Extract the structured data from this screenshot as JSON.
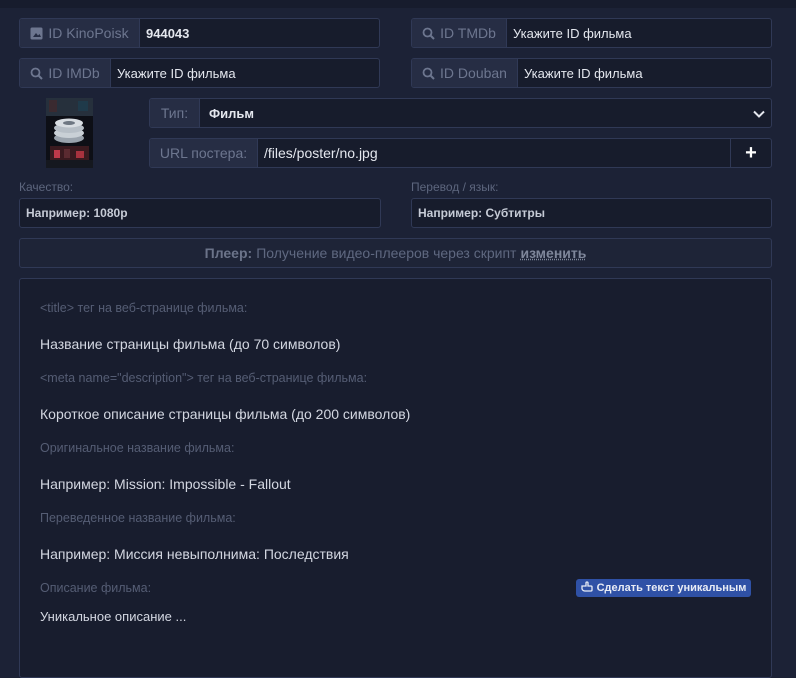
{
  "ids": {
    "kinopoisk": {
      "label": "ID KinoPoisk",
      "value": "944043"
    },
    "tmdb": {
      "label": "ID TMDb",
      "placeholder": "Укажите ID фильма"
    },
    "imdb": {
      "label": "ID IMDb",
      "placeholder": "Укажите ID фильма"
    },
    "douban": {
      "label": "ID Douban",
      "placeholder": "Укажите ID фильма"
    }
  },
  "type": {
    "label": "Тип:",
    "selected": "Фильм"
  },
  "poster": {
    "label": "URL постера:",
    "value": "/files/poster/no.jpg",
    "add_button": "+"
  },
  "quality": {
    "label": "Качество:",
    "placeholder": "Например: 1080p"
  },
  "translation": {
    "label": "Перевод / язык:",
    "placeholder": "Например: Субтитры"
  },
  "player": {
    "label": "Плеер:",
    "text": "Получение видео-плееров через скрипт",
    "change_link": "изменить"
  },
  "seo": {
    "title_hint": "<title> тег на веб-странице фильма:",
    "title_placeholder": "Название страницы фильма (до 70 символов)",
    "description_hint": "<meta name=\"description\"> тег на веб-странице фильма:",
    "description_placeholder": "Короткое описание страницы фильма (до 200 символов)"
  },
  "names": {
    "original_hint": "Оригинальное название фильма:",
    "original_placeholder": "Например: Mission: Impossible - Fallout",
    "translated_hint": "Переведенное название фильма:",
    "translated_placeholder": "Например: Миссия невыполнима: Последствия"
  },
  "description": {
    "hint": "Описание фильма:",
    "unique_button": "Сделать текст уникальным",
    "placeholder": "Уникальное описание ..."
  },
  "colors": {
    "background": "#1c2236",
    "accent_button": "#2f51a6"
  }
}
